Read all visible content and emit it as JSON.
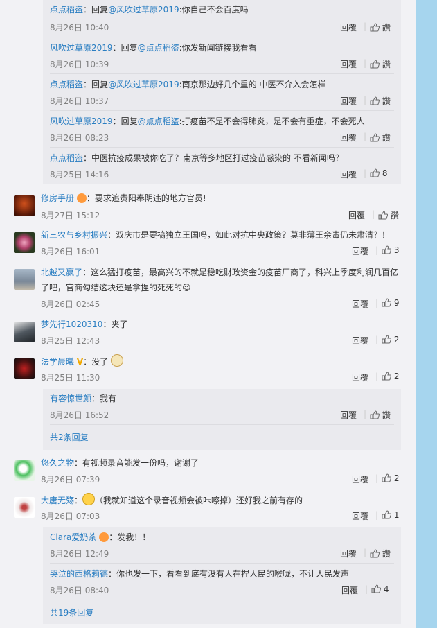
{
  "thread_a": {
    "replies": [
      {
        "user": "点点稻盗",
        "reply_prefix": "回复",
        "mention": "@风吹过草原2019",
        "text": ":你自己不会百度吗",
        "time": "8月26日 10:40",
        "reply_label": "回覆",
        "like_label": "讚"
      },
      {
        "user": "风吹过草原2019",
        "reply_prefix": "回复",
        "mention": "@点点稻盗",
        "text": ":你发新闻链接我看看",
        "time": "8月26日 10:39",
        "reply_label": "回覆",
        "like_label": "讚"
      },
      {
        "user": "点点稻盗",
        "reply_prefix": "回复",
        "mention": "@风吹过草原2019",
        "text": ":南京那边好几个重的 中医不介入会怎样",
        "time": "8月26日 10:37",
        "reply_label": "回覆",
        "like_label": "讚"
      },
      {
        "user": "风吹过草原2019",
        "reply_prefix": "回复",
        "mention": "@点点稻盗",
        "text": ":打疫苗不是不会得肺炎，是不会有重症，不会死人",
        "time": "8月26日 08:23",
        "reply_label": "回覆",
        "like_label": "讚"
      },
      {
        "user": "点点稻盗",
        "reply_prefix": "",
        "mention": "",
        "text": "：中医抗疫成果被你吃了？南京等多地区打过疫苗感染的 不看新闻吗？",
        "time": "8月25日 14:16",
        "reply_label": "回覆",
        "like_label": "8"
      }
    ]
  },
  "comments": [
    {
      "user": "修房手册",
      "text": "：要求追责阳奉阴违的地方官员!",
      "time": "8月27日 15:12",
      "reply_label": "回覆",
      "like_label": "讚"
    },
    {
      "user": "新三农与乡村振兴",
      "text": "：双庆市是要搞独立王国吗，如此对抗中央政策？莫非薄王余毒仍未肃清？！",
      "time": "8月26日 16:01",
      "reply_label": "回覆",
      "like_label": "3"
    },
    {
      "user": "北越又赢了",
      "text": "：这么猛打疫苗，最高兴的不就是稳吃财政资金的疫苗厂商了，科兴上季度利润几百亿了吧，官商勾结这块还是拿捏的死死的😉",
      "time": "8月26日 02:45",
      "reply_label": "回覆",
      "like_label": "9"
    },
    {
      "user": "梦先行1020310",
      "text": "：夹了",
      "time": "8月25日 12:43",
      "reply_label": "回覆",
      "like_label": "2"
    },
    {
      "user": "法学晨曦",
      "text": "：没了",
      "time": "8月25日 11:30",
      "reply_label": "回覆",
      "like_label": "2"
    },
    {
      "user": "悠久之物",
      "text": "：有视频录音能发一份吗，谢谢了",
      "time": "8月26日 07:39",
      "reply_label": "回覆",
      "like_label": "2"
    },
    {
      "user": "大唐无殇",
      "text": "（我就知道这个录音视频会被咔嚓掉）还好我之前有存的",
      "time": "8月26日 07:03",
      "reply_label": "回覆",
      "like_label": "1"
    }
  ],
  "thread_b": {
    "reply": {
      "user": "有容惊世颜",
      "text": "：我有",
      "time": "8月26日 16:52",
      "reply_label": "回覆",
      "like_label": "讚"
    },
    "more": "共2条回复"
  },
  "thread_c": {
    "replies": [
      {
        "user": "Clara爱奶茶",
        "text": "：发我！！",
        "time": "8月26日 12:49",
        "reply_label": "回覆",
        "like_label": "讚"
      },
      {
        "user": "哭泣的西格莉德",
        "text": "：你也发一下，看看到底有没有人在捏人民的喉咙，不让人民发声",
        "time": "8月26日 08:40",
        "reply_label": "回覆",
        "like_label": "4"
      }
    ],
    "more": "共19条回复"
  }
}
